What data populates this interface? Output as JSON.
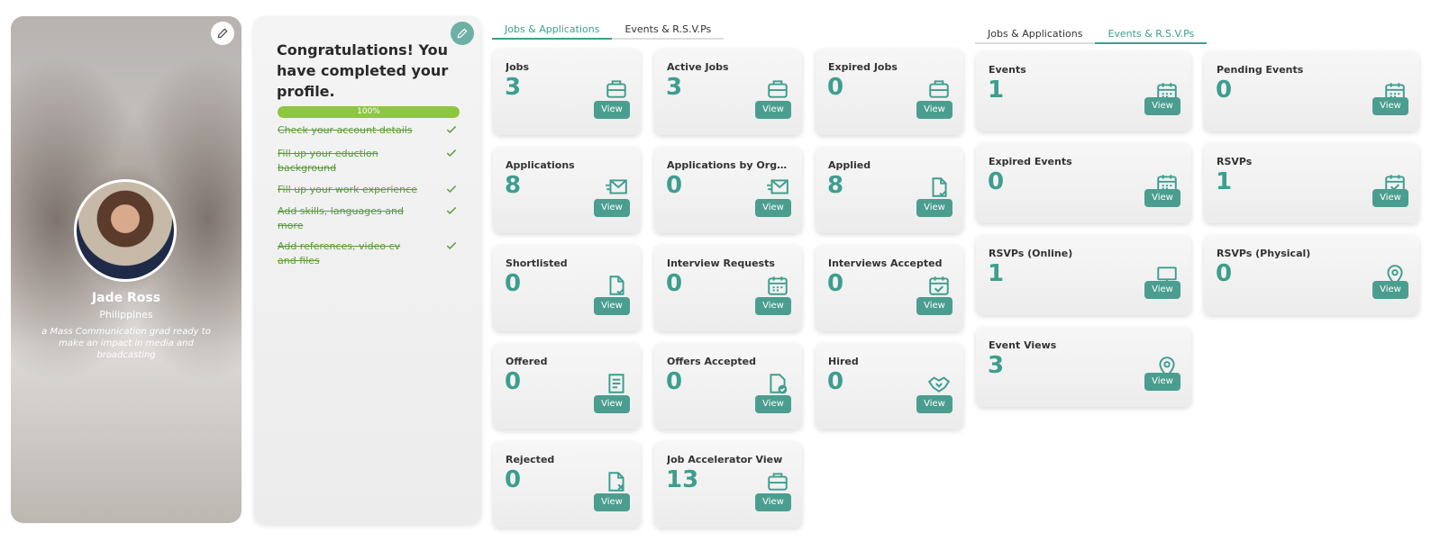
{
  "profile": {
    "name": "Jade Ross",
    "country": "Philippines",
    "bio": "a Mass Communication grad ready to make an impact in media and broadcasting"
  },
  "completion": {
    "title": "Congratulations! You have completed your profile.",
    "progress_percent": 100,
    "progress_label": "100%",
    "tasks": [
      {
        "label": "Check your account details",
        "done": true
      },
      {
        "label": "Fill up your eduction background",
        "done": true
      },
      {
        "label": "Fill up your work experience",
        "done": true
      },
      {
        "label": "Add skills, languages and more",
        "done": true
      },
      {
        "label": "Add references, video cv and files",
        "done": true
      }
    ]
  },
  "jobs_section": {
    "tabs": [
      {
        "label": "Jobs & Applications",
        "active": true
      },
      {
        "label": "Events & R.S.V.Ps",
        "active": false
      }
    ],
    "cards": [
      {
        "title": "Jobs",
        "value": "3",
        "icon": "briefcase-icon",
        "button": "View"
      },
      {
        "title": "Active Jobs",
        "value": "3",
        "icon": "briefcase-icon",
        "button": "View"
      },
      {
        "title": "Expired Jobs",
        "value": "0",
        "icon": "briefcase-icon",
        "button": "View"
      },
      {
        "title": "Applications",
        "value": "8",
        "icon": "send-mail-icon",
        "button": "View"
      },
      {
        "title": "Applications by Orga...",
        "value": "0",
        "icon": "send-mail-icon",
        "button": "View"
      },
      {
        "title": "Applied",
        "value": "8",
        "icon": "document-check-icon",
        "button": "View"
      },
      {
        "title": "Shortlisted",
        "value": "0",
        "icon": "document-check-icon",
        "button": "View"
      },
      {
        "title": "Interview Requests",
        "value": "0",
        "icon": "calendar-icon",
        "button": "View"
      },
      {
        "title": "Interviews Accepted",
        "value": "0",
        "icon": "calendar-check-icon",
        "button": "View"
      },
      {
        "title": "Offered",
        "value": "0",
        "icon": "document-list-icon",
        "button": "View"
      },
      {
        "title": "Offers Accepted",
        "value": "0",
        "icon": "document-badge-icon",
        "button": "View"
      },
      {
        "title": "Hired",
        "value": "0",
        "icon": "handshake-icon",
        "button": "View"
      },
      {
        "title": "Rejected",
        "value": "0",
        "icon": "document-x-icon",
        "button": "View"
      },
      {
        "title": "Job Accelerator View",
        "value": "13",
        "icon": "briefcase-icon",
        "button": "View"
      }
    ]
  },
  "events_section": {
    "tabs": [
      {
        "label": "Jobs & Applications",
        "active": false
      },
      {
        "label": "Events & R.S.V.Ps",
        "active": true
      }
    ],
    "cards": [
      {
        "title": "Events",
        "value": "1",
        "icon": "calendar-icon",
        "button": "View"
      },
      {
        "title": "Pending Events",
        "value": "0",
        "icon": "calendar-icon",
        "button": "View"
      },
      {
        "title": "Expired Events",
        "value": "0",
        "icon": "calendar-icon",
        "button": "View"
      },
      {
        "title": "RSVPs",
        "value": "1",
        "icon": "calendar-check-icon",
        "button": "View"
      },
      {
        "title": "RSVPs (Online)",
        "value": "1",
        "icon": "monitor-icon",
        "button": "View"
      },
      {
        "title": "RSVPs (Physical)",
        "value": "0",
        "icon": "location-pin-icon",
        "button": "View"
      },
      {
        "title": "Event Views",
        "value": "3",
        "icon": "location-pin-icon",
        "button": "View"
      }
    ]
  },
  "colors": {
    "accent": "#3d9e8e",
    "button": "#4b9e8f",
    "progress": "#8dc63f",
    "done_task": "#5a9b3a"
  }
}
